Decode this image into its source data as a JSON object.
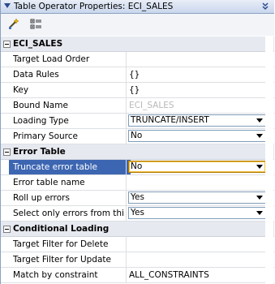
{
  "title": "Table Operator Properties: ECI_SALES",
  "toolbar": {
    "icons": [
      "wand-icon",
      "categorize-icon"
    ]
  },
  "rows": [
    {
      "kind": "category",
      "label": "ECI_SALES"
    },
    {
      "kind": "prop",
      "name": "Target Load Order",
      "value": ""
    },
    {
      "kind": "prop",
      "name": "Data Rules",
      "value": "{}"
    },
    {
      "kind": "prop",
      "name": "Key",
      "value": "{}"
    },
    {
      "kind": "prop",
      "name": "Bound Name",
      "value": "ECI_SALES",
      "disabled": true
    },
    {
      "kind": "combo",
      "name": "Loading Type",
      "value": "TRUNCATE/INSERT"
    },
    {
      "kind": "combo",
      "name": "Primary Source",
      "value": "No"
    },
    {
      "kind": "category",
      "label": "Error Table"
    },
    {
      "kind": "combo",
      "name": "Truncate error table",
      "value": "No",
      "selected": true
    },
    {
      "kind": "prop",
      "name": "Error table name",
      "value": ""
    },
    {
      "kind": "combo",
      "name": "Roll up errors",
      "value": "Yes"
    },
    {
      "kind": "combo",
      "name": "Select only errors from thi...",
      "value": "Yes"
    },
    {
      "kind": "category",
      "label": "Conditional Loading"
    },
    {
      "kind": "prop",
      "name": "Target Filter for Delete",
      "value": ""
    },
    {
      "kind": "prop",
      "name": "Target Filter for Update",
      "value": ""
    },
    {
      "kind": "prop",
      "name": "Match by constraint",
      "value": "ALL_CONSTRAINTS"
    }
  ]
}
